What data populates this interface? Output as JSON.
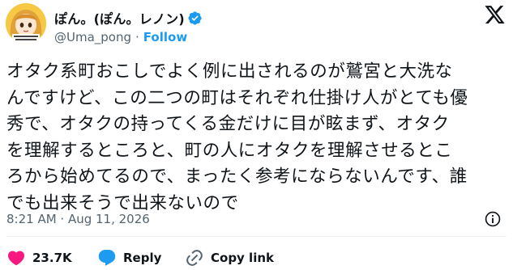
{
  "author": {
    "display_name": "ぽん。(ぽん。レノン)",
    "handle": "@Uma_pong",
    "separator": "·",
    "follow_label": "Follow",
    "verified_color": "#1d9bf0",
    "avatar_icon": "anime-character-avatar-icon"
  },
  "tweet": {
    "lines": [
      "オタク系町おこしでよく例に出されるのが鷲宮と大洗な",
      "んですけど、この二つの町はそれぞれ仕掛け人がとても優",
      "秀で、オタクの持ってくる金だけに目が眩まず、オタク",
      "を理解するところと、町の人にオタクを理解させるとこ",
      "ろから始めてるので、まったく参考にならないんです、誰",
      "でも出来そうで出来ないので"
    ],
    "timestamp": "8:21 AM · Aug 11, 2026"
  },
  "actions": {
    "like_count": "23.7K",
    "like_color": "#f91880",
    "reply_label": "Reply",
    "reply_color": "#1d9bf0",
    "copy_label": "Copy link"
  },
  "icons": {
    "logo": "x-logo-icon",
    "info": "info-icon",
    "like": "heart-icon",
    "reply": "reply-bubble-icon",
    "copy": "link-icon"
  }
}
